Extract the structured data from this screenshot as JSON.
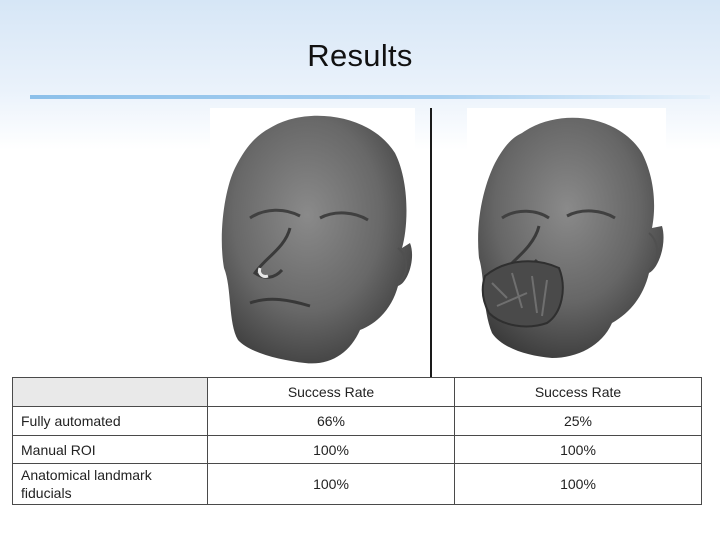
{
  "slide": {
    "title": "Results"
  },
  "images": {
    "left": "3d-face-render-complete",
    "right": "3d-face-render-mouth-artifact"
  },
  "table": {
    "headers": [
      "",
      "Success Rate",
      "Success Rate"
    ],
    "rows": [
      {
        "label": "Fully automated",
        "values": [
          "66%",
          "25%"
        ]
      },
      {
        "label": "Manual ROI",
        "values": [
          "100%",
          "100%"
        ]
      },
      {
        "label": "Anatomical landmark fiducials",
        "values": [
          "100%",
          "100%"
        ]
      }
    ]
  },
  "colors": {
    "title_rule": "#8cc0ea",
    "header_corner": "#e9e9e9",
    "face_render": "#6b6b6b"
  }
}
